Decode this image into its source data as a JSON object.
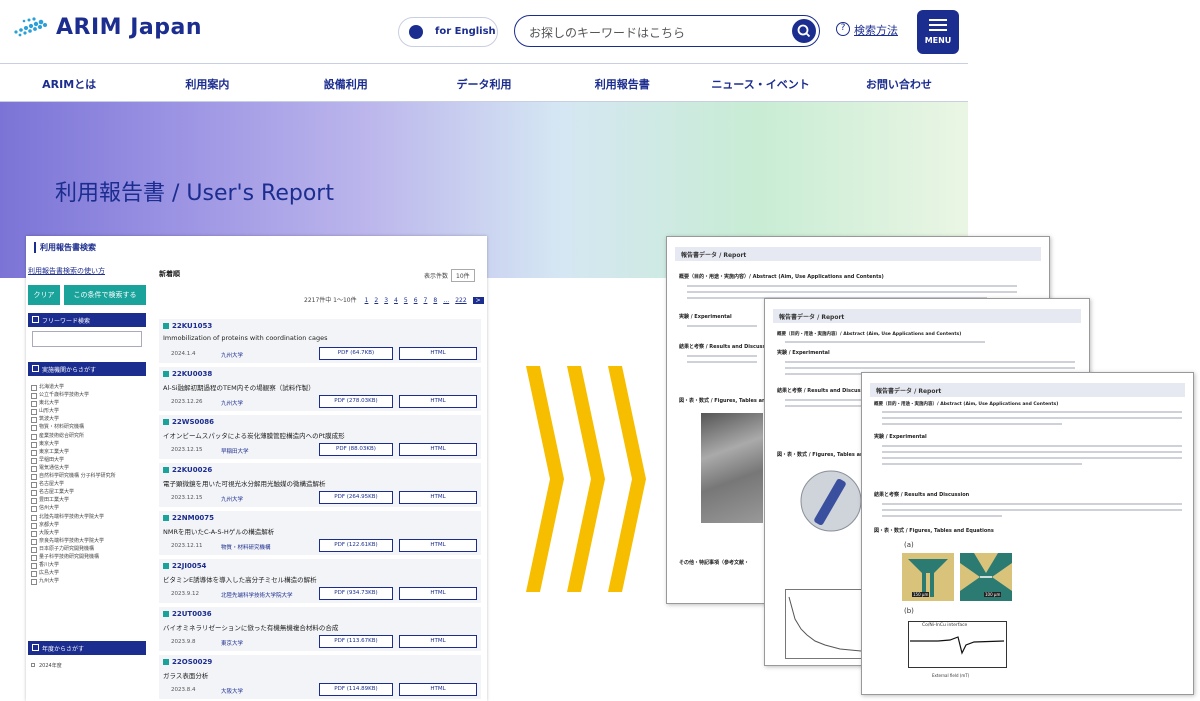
{
  "header": {
    "logo_text": "ARIM Japan",
    "lang_label": "for English",
    "search_placeholder": "お探しのキーワードはこちら",
    "help_label": "検索方法",
    "menu_label": "MENU"
  },
  "nav": [
    "ARIMとは",
    "利用案内",
    "設備利用",
    "データ利用",
    "利用報告書",
    "ニュース・イベント",
    "お問い合わせ"
  ],
  "hero": {
    "title": "利用報告書 / User's Report"
  },
  "search_panel": {
    "title": "利用報告書検索",
    "howto_link": "利用報告書検索の使い方",
    "clear_btn": "クリア",
    "search_btn": "この条件で検索する",
    "freeword_label": "フリーワード検索",
    "institution_label": "実施機関からさがす",
    "institutions": [
      "北海道大学",
      "公立千歳科学技術大学",
      "東北大学",
      "山形大学",
      "筑波大学",
      "物質・材料研究機構",
      "産業技術総合研究所",
      "東京大学",
      "東京工業大学",
      "早稲田大学",
      "電気通信大学",
      "自然科学研究機構 分子科学研究所",
      "名古屋大学",
      "名古屋工業大学",
      "豊田工業大学",
      "信州大学",
      "北陸先端科学技術大学院大学",
      "京都大学",
      "大阪大学",
      "奈良先端科学技術大学院大学",
      "日本原子力研究開発機構",
      "量子科学技術研究開発機構",
      "香川大学",
      "広島大学",
      "九州大学"
    ],
    "year_label": "年度からさがす",
    "year_first": "2024年度"
  },
  "list": {
    "heading": "新着順",
    "display_label": "表示件数",
    "display_value": "10件",
    "pager_info": "2217件中 1〜10件",
    "pages": [
      "1",
      "2",
      "3",
      "4",
      "5",
      "6",
      "7",
      "8",
      "…",
      "222"
    ],
    "next": ">",
    "reports": [
      {
        "id": "22KU1053",
        "title": "Immobilization of proteins with coordination cages",
        "date": "2024.1.4",
        "inst": "九州大学",
        "pdf": "PDF (64.7KB)",
        "html": "HTML"
      },
      {
        "id": "22KU0038",
        "title": "Al-Si融解初期過程のTEM内その場観察（試料作製）",
        "date": "2023.12.26",
        "inst": "九州大学",
        "pdf": "PDF (278.03KB)",
        "html": "HTML"
      },
      {
        "id": "22WS0086",
        "title": "イオンビームスパッタによる炭化薄膜管腔構造内へのPt膜成形",
        "date": "2023.12.15",
        "inst": "早稲田大学",
        "pdf": "PDF (88.03KB)",
        "html": "HTML"
      },
      {
        "id": "22KU0026",
        "title": "電子顕微鏡を用いた可視光水分解用光触媒の微構造解析",
        "date": "2023.12.15",
        "inst": "九州大学",
        "pdf": "PDF (264.95KB)",
        "html": "HTML"
      },
      {
        "id": "22NM0075",
        "title": "NMRを用いたC-A-S-Hゲルの構造解析",
        "date": "2023.12.11",
        "inst": "物質・材料研究機構",
        "pdf": "PDF (122.61KB)",
        "html": "HTML"
      },
      {
        "id": "22JI0054",
        "title": "ビタミンE誘導体を導入した高分子ミセル構造の解析",
        "date": "2023.9.12",
        "inst": "北陸先端科学技術大学院大学",
        "pdf": "PDF (934.73KB)",
        "html": "HTML"
      },
      {
        "id": "22UT0036",
        "title": "バイオミネラリゼーションに倣った有機無機複合材料の合成",
        "date": "2023.9.8",
        "inst": "東京大学",
        "pdf": "PDF (113.67KB)",
        "html": "HTML"
      },
      {
        "id": "22OS0029",
        "title": "ガラス表面分析",
        "date": "2023.8.4",
        "inst": "大阪大学",
        "pdf": "PDF (114.89KB)",
        "html": "HTML"
      }
    ]
  },
  "docs": {
    "header": "報告書データ / Report",
    "abstract": "概要（目的・用途・実施内容）/ Abstract (Aim, Use Applications and Contents)",
    "experimental": "実験 / Experimental",
    "results": "結果と考察 / Results and Discussion",
    "figures": "図・表・数式 / Figures, Tables and Equations",
    "other": "その他・特記事項（参考文献・",
    "fig_a": "(a)",
    "fig_b": "(b)",
    "scale1": "150 μm",
    "scale2": "100 μm",
    "interface": "Co/Ni-InCu interface",
    "xaxis": "External field (mT)"
  }
}
